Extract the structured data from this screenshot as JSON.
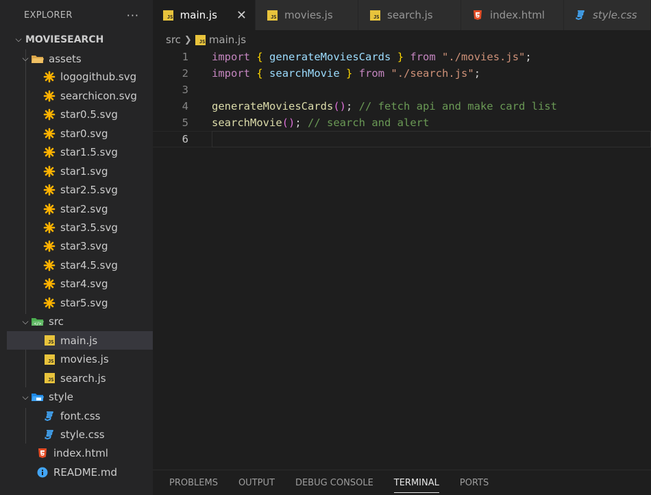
{
  "explorer": {
    "title": "EXPLORER",
    "more": "···",
    "project": "MOVIESEARCH",
    "folders": {
      "assets": "assets",
      "src": "src",
      "style": "style"
    },
    "assets_files": [
      "logogithub.svg",
      "searchicon.svg",
      "star0.5.svg",
      "star0.svg",
      "star1.5.svg",
      "star1.svg",
      "star2.5.svg",
      "star2.svg",
      "star3.5.svg",
      "star3.svg",
      "star4.5.svg",
      "star4.svg",
      "star5.svg"
    ],
    "src_files": [
      "main.js",
      "movies.js",
      "search.js"
    ],
    "style_files": [
      "font.css",
      "style.css"
    ],
    "root_files": [
      "index.html",
      "README.md"
    ],
    "selected_file": "main.js"
  },
  "tabs": [
    {
      "label": "main.js",
      "type": "js",
      "active": true
    },
    {
      "label": "movies.js",
      "type": "js"
    },
    {
      "label": "search.js",
      "type": "js"
    },
    {
      "label": "index.html",
      "type": "html"
    },
    {
      "label": "style.css",
      "type": "css"
    }
  ],
  "tab_close": "✕",
  "breadcrumb": {
    "folder": "src",
    "file": "main.js"
  },
  "code": {
    "line_numbers": [
      "1",
      "2",
      "3",
      "4",
      "5",
      "6"
    ],
    "current_line": "6",
    "l1": {
      "kw1": "import",
      "b1": "{",
      "id": "generateMoviesCards",
      "b2": "}",
      "kw2": "from",
      "str": "\"./movies.js\"",
      "semi": ";"
    },
    "l2": {
      "kw1": "import",
      "b1": "{",
      "id": "searchMovie",
      "b2": "}",
      "kw2": "from",
      "str": "\"./search.js\"",
      "semi": ";"
    },
    "l4": {
      "fn": "generateMoviesCards",
      "paren": "()",
      "semi": ";",
      "comment": "// fetch api and make card list"
    },
    "l5": {
      "fn": "searchMovie",
      "paren": "()",
      "semi": ";",
      "comment": "// search and alert"
    }
  },
  "panel_tabs": [
    "PROBLEMS",
    "OUTPUT",
    "DEBUG CONSOLE",
    "TERMINAL",
    "PORTS"
  ],
  "panel_active": "TERMINAL",
  "colors": {
    "js_icon": "#e8c33c",
    "html_icon": "#e44d26",
    "css_icon": "#42a5f5",
    "svg_icon": "#ffb300",
    "info_icon": "#42a5f5"
  }
}
